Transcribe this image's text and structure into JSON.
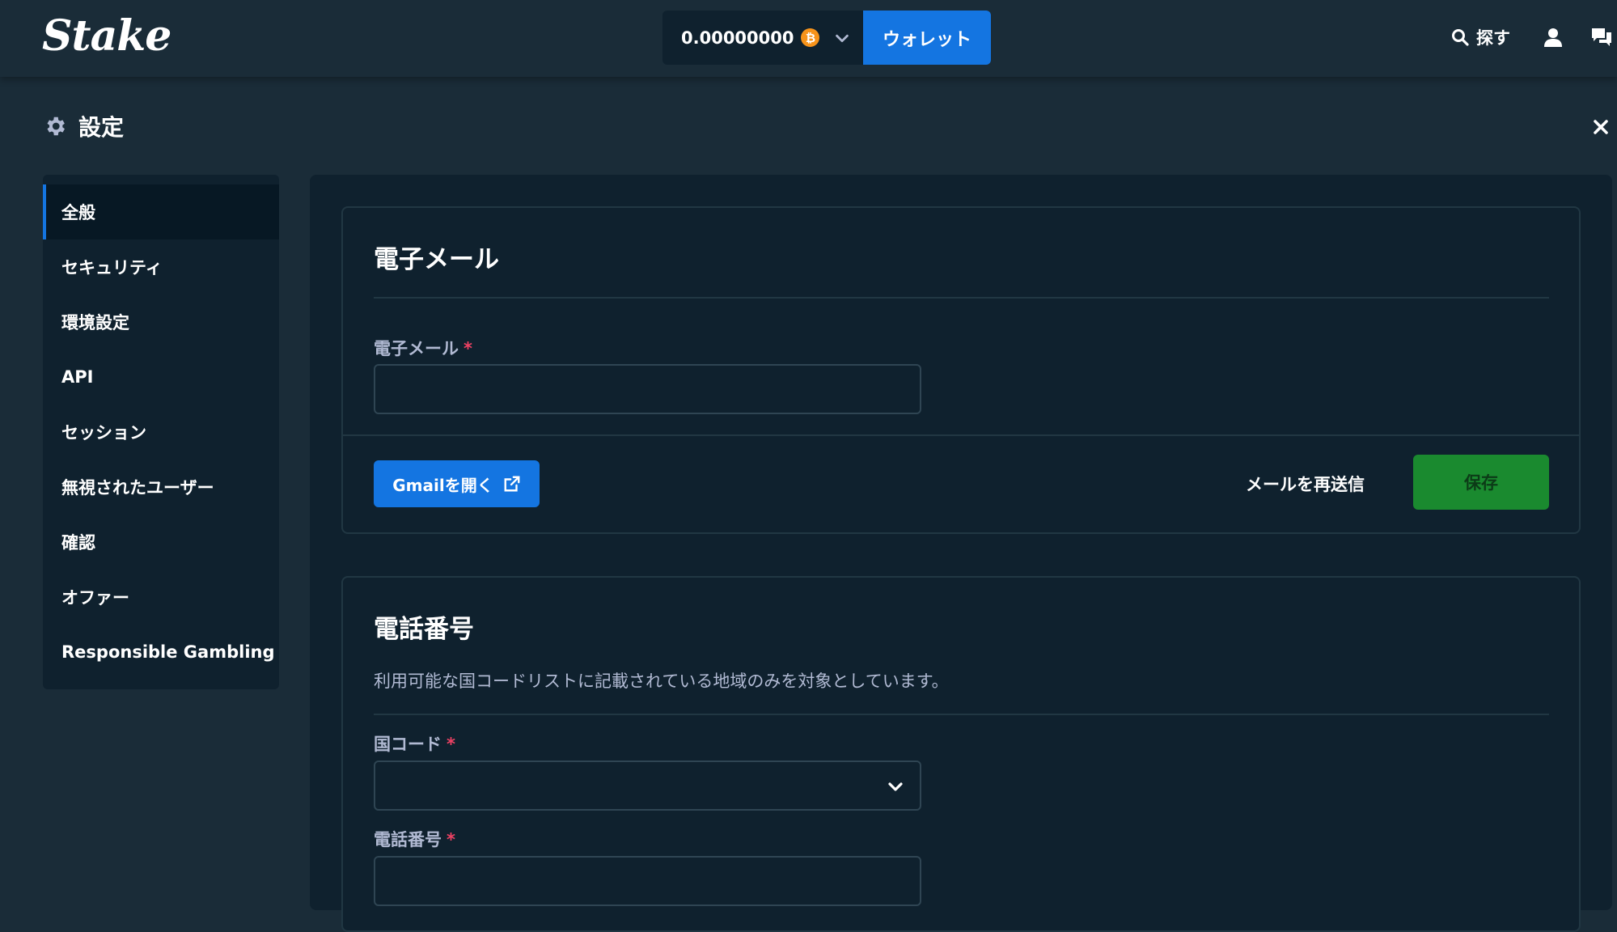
{
  "topbar": {
    "logo": "Stake",
    "balance_amount": "0.00000000",
    "currency_icon": "bitcoin-icon",
    "wallet_label": "ウォレット",
    "search_label": "探す",
    "icons": [
      "search-icon",
      "user-icon",
      "chat-icon",
      "chevron-down-icon"
    ]
  },
  "settings": {
    "title": "設定",
    "icon": "gear-icon",
    "close_icon": "close-icon"
  },
  "sidebar": {
    "items": [
      {
        "label": "全般",
        "active": true
      },
      {
        "label": "セキュリティ"
      },
      {
        "label": "環境設定"
      },
      {
        "label": "API"
      },
      {
        "label": "セッション"
      },
      {
        "label": "無視されたユーザー"
      },
      {
        "label": "確認"
      },
      {
        "label": "オファー"
      },
      {
        "label": "Responsible Gambling"
      }
    ]
  },
  "email_section": {
    "title": "電子メール",
    "field_label": "電子メール",
    "required_mark": "*",
    "email_value": "",
    "gmail_button": "Gmailを開く",
    "resend_label": "メールを再送信",
    "save_label": "保存"
  },
  "phone_section": {
    "title": "電話番号",
    "description": "利用可能な国コードリストに記載されている地域のみを対象としています。",
    "country_code_label": "国コード",
    "country_code_value": "",
    "phone_label": "電話番号",
    "phone_value": "",
    "required_mark": "*"
  },
  "colors": {
    "background": "#1a2c38",
    "panel": "#0f212e",
    "accent_blue": "#1475e1",
    "save_green": "#1a8a2f",
    "required_red": "#ed4163",
    "muted_text": "#b1bad3",
    "bitcoin": "#f7931a"
  }
}
